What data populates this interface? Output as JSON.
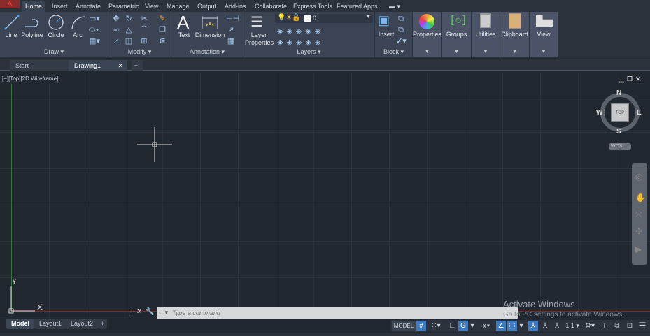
{
  "app": {
    "logo": "A"
  },
  "ribbon_tabs": [
    "Home",
    "Insert",
    "Annotate",
    "Parametric",
    "View",
    "Manage",
    "Output",
    "Add-ins",
    "Collaborate",
    "Express Tools",
    "Featured Apps"
  ],
  "draw": {
    "line": "Line",
    "polyline": "Polyline",
    "circle": "Circle",
    "arc": "Arc",
    "label": "Draw ▾"
  },
  "modify": {
    "label": "Modify ▾"
  },
  "annotation": {
    "text": "Text",
    "dimension": "Dimension",
    "label": "Annotation ▾"
  },
  "layers": {
    "layer_properties_1": "Layer",
    "layer_properties_2": "Properties",
    "current_layer": "0",
    "label": "Layers ▾"
  },
  "block": {
    "insert": "Insert",
    "label": "Block ▾"
  },
  "big_buttons": [
    "Properties",
    "Groups",
    "Utilities",
    "Clipboard",
    "View"
  ],
  "file_tabs": {
    "start": "Start",
    "drawing": "Drawing1",
    "close": "✕",
    "new": "+"
  },
  "viewport": {
    "label": "[−][Top][2D Wireframe]",
    "ucs_y": "Y",
    "ucs_x": "X"
  },
  "viewcube": {
    "n": "N",
    "s": "S",
    "e": "E",
    "w": "W",
    "top": "TOP",
    "wcs": "WCS"
  },
  "window_controls": {
    "min": "▁",
    "restore": "❐",
    "close": "✕"
  },
  "command": {
    "placeholder": "Type a command"
  },
  "layout_tabs": [
    "Model",
    "Layout1",
    "Layout2",
    "+"
  ],
  "status": {
    "model": "MODEL",
    "scale": "1:1 ▾"
  },
  "watermark": {
    "title": "Activate Windows",
    "subtitle": "Go to PC settings to activate Windows."
  },
  "colors": {
    "ribbon": "#3b4453",
    "viewport": "#212830",
    "accent": "#3d7ac0"
  }
}
